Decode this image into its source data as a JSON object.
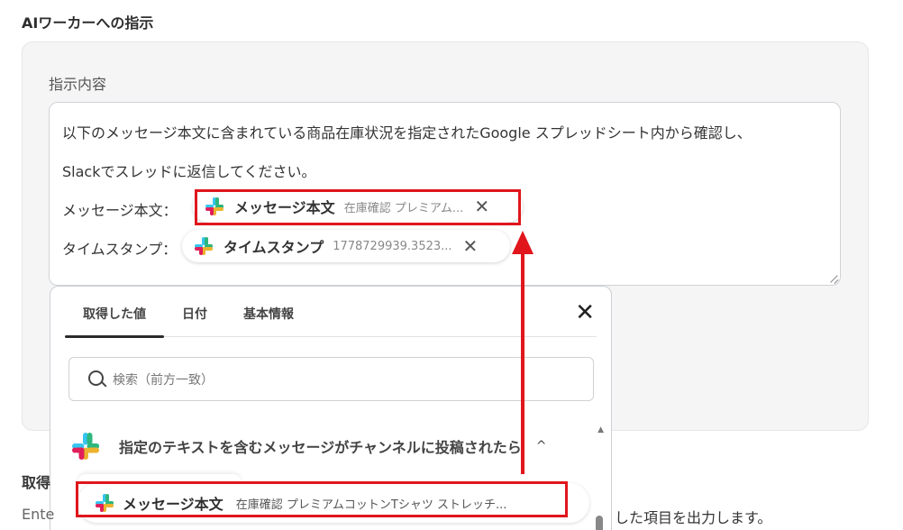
{
  "section": {
    "title": "AIワーカーへの指示"
  },
  "instruction": {
    "label": "指示内容",
    "line1": "以下のメッセージ本文に含まれている商品在庫状況を指定されたGoogle スプレッドシート内から確認し、",
    "line2": "Slackでスレッドに返信してください。",
    "message_label": "メッセージ本文：",
    "timestamp_label": "タイムスタンプ："
  },
  "chips": {
    "message": {
      "name": "メッセージ本文",
      "value": "在庫確認 プレミアム...",
      "close": "✕"
    },
    "timestamp": {
      "name": "タイムスタンプ",
      "value": "1778729939.3523...",
      "close": "✕"
    }
  },
  "picker": {
    "tabs": [
      {
        "label": "取得した値"
      },
      {
        "label": "日付"
      },
      {
        "label": "基本情報"
      }
    ],
    "close": "✕",
    "search_placeholder": "検索（前方一致）",
    "group_title": "指定のテキストを含むメッセージがチャンネルに投稿されたら",
    "group_chevron": "^",
    "item": {
      "name": "メッセージ本文",
      "value": "在庫確認 プレミアムコットンTシャツ ストレッチ..."
    }
  },
  "bottom": {
    "heading": "取得",
    "text_left": "Ente",
    "text_right": "した項目を出力します。"
  },
  "colors": {
    "highlight": "#e0161c",
    "slack_blue": "#36c5f0",
    "slack_green": "#2eb67d",
    "slack_yellow": "#ecb22e",
    "slack_red": "#e01e5a"
  },
  "icons": [
    "slack-logo-icon",
    "close-icon",
    "search-icon",
    "chevron-up-icon",
    "resize-handle-icon"
  ]
}
